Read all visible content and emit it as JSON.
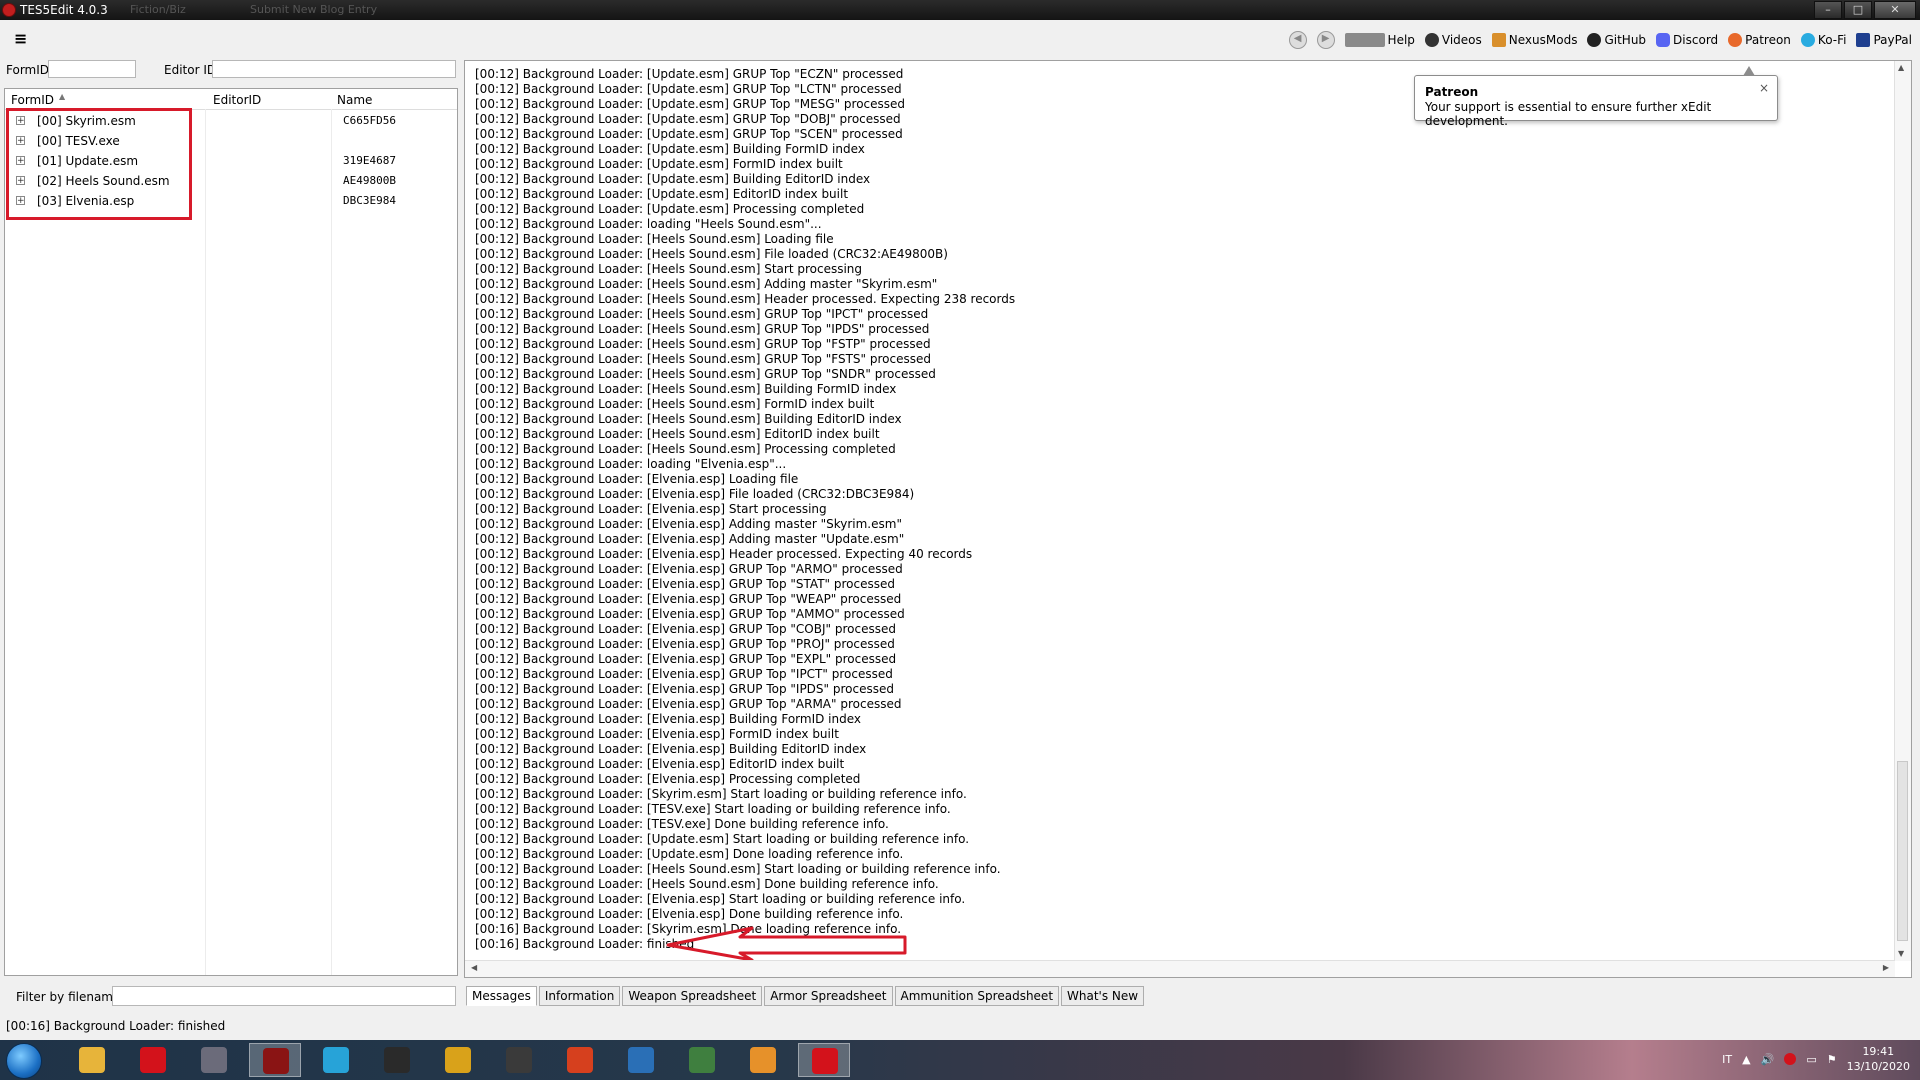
{
  "window": {
    "title": "TES5Edit 4.0.3",
    "faded_tabs": [
      "Fiction/Biz",
      "Submit New Blog Entry"
    ]
  },
  "toolbar": {
    "menu_glyph": "≡",
    "links": [
      {
        "label": "Help",
        "icon": "book-icon",
        "color": "#6b6b6b"
      },
      {
        "label": "Videos",
        "icon": "github-icon",
        "color": "#333333"
      },
      {
        "label": "NexusMods",
        "icon": "nexusmods-icon",
        "color": "#d98f2b"
      },
      {
        "label": "GitHub",
        "icon": "octocat-icon",
        "color": "#222222"
      },
      {
        "label": "Discord",
        "icon": "discord-icon",
        "color": "#5865f2"
      },
      {
        "label": "Patreon",
        "icon": "patreon-icon",
        "color": "#e8692b"
      },
      {
        "label": "Ko-Fi",
        "icon": "kofi-icon",
        "color": "#29abe0"
      },
      {
        "label": "PayPal",
        "icon": "paypal-icon",
        "color": "#1f3f8f"
      }
    ]
  },
  "search": {
    "formid_label": "FormID",
    "formid_value": "",
    "editorid_label": "Editor ID",
    "editorid_value": ""
  },
  "tree": {
    "columns": [
      "FormID",
      "EditorID",
      "Name"
    ],
    "rows": [
      {
        "name": "[00] Skyrim.esm",
        "crc": "C665FD56"
      },
      {
        "name": "[00] TESV.exe",
        "crc": ""
      },
      {
        "name": "[01] Update.esm",
        "crc": "319E4687"
      },
      {
        "name": "[02] Heels Sound.esm",
        "crc": "AE49800B"
      },
      {
        "name": "[03] Elvenia.esp",
        "crc": "DBC3E984"
      }
    ]
  },
  "filter": {
    "label": "Filter by filename:",
    "value": ""
  },
  "log_lines": [
    "[00:12] Background Loader: [Update.esm] GRUP Top \"ECZN\" processed",
    "[00:12] Background Loader: [Update.esm] GRUP Top \"LCTN\" processed",
    "[00:12] Background Loader: [Update.esm] GRUP Top \"MESG\" processed",
    "[00:12] Background Loader: [Update.esm] GRUP Top \"DOBJ\" processed",
    "[00:12] Background Loader: [Update.esm] GRUP Top \"SCEN\" processed",
    "[00:12] Background Loader: [Update.esm] Building FormID index",
    "[00:12] Background Loader: [Update.esm] FormID index built",
    "[00:12] Background Loader: [Update.esm] Building EditorID index",
    "[00:12] Background Loader: [Update.esm] EditorID index built",
    "[00:12] Background Loader: [Update.esm] Processing completed",
    "[00:12] Background Loader: loading \"Heels Sound.esm\"...",
    "[00:12] Background Loader: [Heels Sound.esm] Loading file",
    "[00:12] Background Loader: [Heels Sound.esm] File loaded (CRC32:AE49800B)",
    "[00:12] Background Loader: [Heels Sound.esm] Start processing",
    "[00:12] Background Loader: [Heels Sound.esm] Adding master \"Skyrim.esm\"",
    "[00:12] Background Loader: [Heels Sound.esm] Header processed. Expecting 238 records",
    "[00:12] Background Loader: [Heels Sound.esm] GRUP Top \"IPCT\" processed",
    "[00:12] Background Loader: [Heels Sound.esm] GRUP Top \"IPDS\" processed",
    "[00:12] Background Loader: [Heels Sound.esm] GRUP Top \"FSTP\" processed",
    "[00:12] Background Loader: [Heels Sound.esm] GRUP Top \"FSTS\" processed",
    "[00:12] Background Loader: [Heels Sound.esm] GRUP Top \"SNDR\" processed",
    "[00:12] Background Loader: [Heels Sound.esm] Building FormID index",
    "[00:12] Background Loader: [Heels Sound.esm] FormID index built",
    "[00:12] Background Loader: [Heels Sound.esm] Building EditorID index",
    "[00:12] Background Loader: [Heels Sound.esm] EditorID index built",
    "[00:12] Background Loader: [Heels Sound.esm] Processing completed",
    "[00:12] Background Loader: loading \"Elvenia.esp\"...",
    "[00:12] Background Loader: [Elvenia.esp] Loading file",
    "[00:12] Background Loader: [Elvenia.esp] File loaded (CRC32:DBC3E984)",
    "[00:12] Background Loader: [Elvenia.esp] Start processing",
    "[00:12] Background Loader: [Elvenia.esp] Adding master \"Skyrim.esm\"",
    "[00:12] Background Loader: [Elvenia.esp] Adding master \"Update.esm\"",
    "[00:12] Background Loader: [Elvenia.esp] Header processed. Expecting 40 records",
    "[00:12] Background Loader: [Elvenia.esp] GRUP Top \"ARMO\" processed",
    "[00:12] Background Loader: [Elvenia.esp] GRUP Top \"STAT\" processed",
    "[00:12] Background Loader: [Elvenia.esp] GRUP Top \"WEAP\" processed",
    "[00:12] Background Loader: [Elvenia.esp] GRUP Top \"AMMO\" processed",
    "[00:12] Background Loader: [Elvenia.esp] GRUP Top \"COBJ\" processed",
    "[00:12] Background Loader: [Elvenia.esp] GRUP Top \"PROJ\" processed",
    "[00:12] Background Loader: [Elvenia.esp] GRUP Top \"EXPL\" processed",
    "[00:12] Background Loader: [Elvenia.esp] GRUP Top \"IPCT\" processed",
    "[00:12] Background Loader: [Elvenia.esp] GRUP Top \"IPDS\" processed",
    "[00:12] Background Loader: [Elvenia.esp] GRUP Top \"ARMA\" processed",
    "[00:12] Background Loader: [Elvenia.esp] Building FormID index",
    "[00:12] Background Loader: [Elvenia.esp] FormID index built",
    "[00:12] Background Loader: [Elvenia.esp] Building EditorID index",
    "[00:12] Background Loader: [Elvenia.esp] EditorID index built",
    "[00:12] Background Loader: [Elvenia.esp] Processing completed",
    "[00:12] Background Loader: [Skyrim.esm] Start loading or building reference info.",
    "[00:12] Background Loader: [TESV.exe] Start loading or building reference info.",
    "[00:12] Background Loader: [TESV.exe] Done building reference info.",
    "[00:12] Background Loader: [Update.esm] Start loading or building reference info.",
    "[00:12] Background Loader: [Update.esm] Done loading reference info.",
    "[00:12] Background Loader: [Heels Sound.esm] Start loading or building reference info.",
    "[00:12] Background Loader: [Heels Sound.esm] Done building reference info.",
    "[00:12] Background Loader: [Elvenia.esp] Start loading or building reference info.",
    "[00:12] Background Loader: [Elvenia.esp] Done building reference info.",
    "[00:16] Background Loader: [Skyrim.esm] Done loading reference info.",
    "[00:16] Background Loader: finished"
  ],
  "tooltip": {
    "title": "Patreon",
    "text": "Your support is essential to ensure further xEdit development.",
    "close": "×"
  },
  "tabs": [
    "Messages",
    "Information",
    "Weapon Spreadsheet",
    "Armor Spreadsheet",
    "Ammunition Spreadsheet",
    "What's New"
  ],
  "active_tab": "Messages",
  "status": "[00:16] Background Loader: finished",
  "taskbar": {
    "apps": [
      {
        "name": "file-explorer-icon",
        "color": "#e7b43a"
      },
      {
        "name": "opera-icon",
        "color": "#d3121b"
      },
      {
        "name": "media-center-icon",
        "color": "#6b6b7a"
      },
      {
        "name": "tes5edit-icon",
        "color": "#8a1414",
        "active": true
      },
      {
        "name": "music-icon",
        "color": "#27a3d8"
      },
      {
        "name": "winamp-icon",
        "color": "#2a2a2a"
      },
      {
        "name": "notes-icon",
        "color": "#d9a21a"
      },
      {
        "name": "arrow-icon",
        "color": "#3a3a3a"
      },
      {
        "name": "foxit-icon",
        "color": "#d6401e"
      },
      {
        "name": "ffdec-icon",
        "color": "#2a6fb6"
      },
      {
        "name": "spreadsheet-icon",
        "color": "#3f7f3f"
      },
      {
        "name": "tool-icon",
        "color": "#e6912a"
      },
      {
        "name": "opera-active-icon",
        "color": "#d3121b",
        "active": true
      }
    ],
    "lang": "IT",
    "time": "19:41",
    "date": "13/10/2020"
  },
  "annotation_color": "#d71a2a"
}
